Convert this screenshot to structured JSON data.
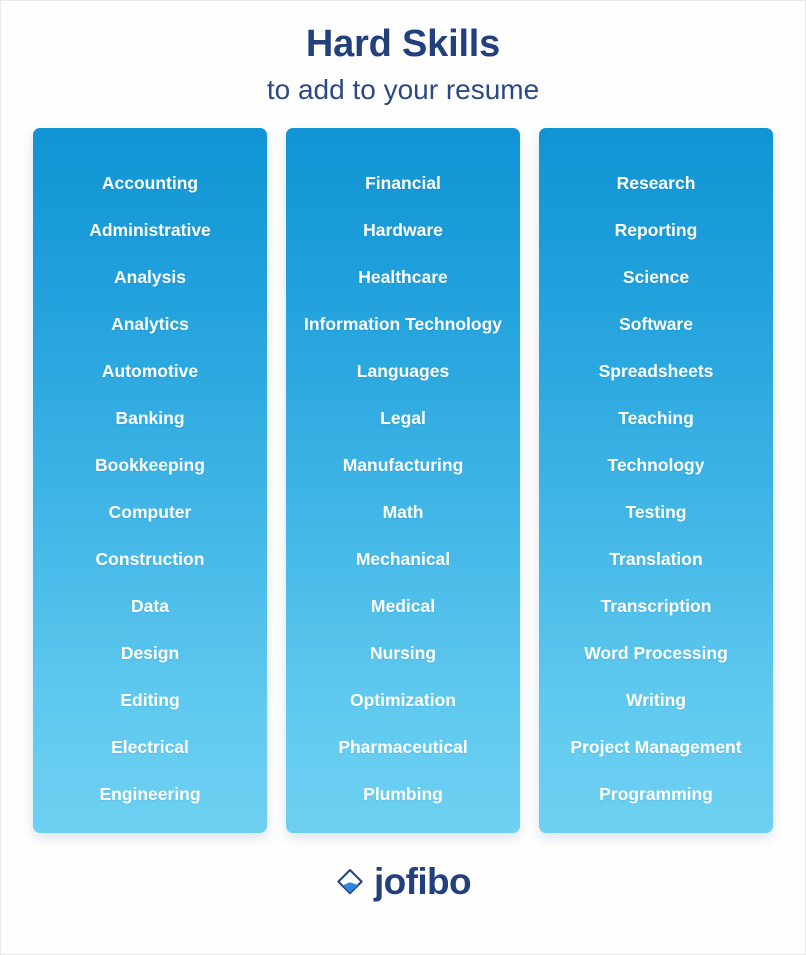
{
  "header": {
    "title": "Hard Skills",
    "subtitle": "to add to your resume"
  },
  "colors": {
    "title_navy": "#22417c",
    "card_gradient_top": "#1094d4",
    "card_gradient_bottom": "#6ed0f2",
    "item_text": "#ffffff",
    "background": "#fefefe"
  },
  "columns": [
    {
      "id": "column-1",
      "items": [
        "Accounting",
        "Administrative",
        "Analysis",
        "Analytics",
        "Automotive",
        "Banking",
        "Bookkeeping",
        "Computer",
        "Construction",
        "Data",
        "Design",
        "Editing",
        "Electrical",
        "Engineering"
      ]
    },
    {
      "id": "column-2",
      "items": [
        "Financial",
        "Hardware",
        "Healthcare",
        "Information Technology",
        "Languages",
        "Legal",
        "Manufacturing",
        "Math",
        "Mechanical",
        "Medical",
        "Nursing",
        "Optimization",
        "Pharmaceutical",
        "Plumbing"
      ]
    },
    {
      "id": "column-3",
      "items": [
        "Research",
        "Reporting",
        "Science",
        "Software",
        "Spreadsheets",
        "Teaching",
        "Technology",
        "Testing",
        "Translation",
        "Transcription",
        "Word Processing",
        "Writing",
        "Project Management",
        "Programming"
      ]
    }
  ],
  "footer": {
    "brand": "jofibo",
    "logo_icon": "jofibo-diamond-droplet-icon"
  }
}
